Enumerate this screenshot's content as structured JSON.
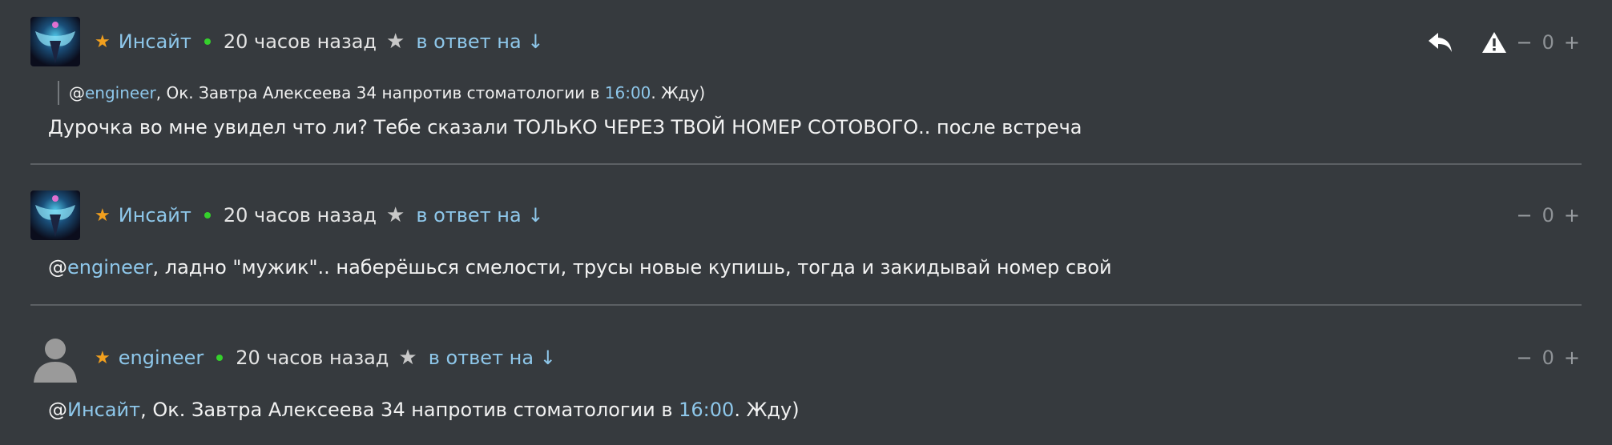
{
  "comments": [
    {
      "author": "Инсайт",
      "time": "20 часов назад",
      "reply_to": "в ответ на ↓",
      "vote_minus": "−",
      "score": "0",
      "vote_plus": "+",
      "quote": {
        "at": "@",
        "mention": "engineer",
        "text_a": ", Ок. Завтра Алексеева 34 напротив стоматологии в ",
        "time": "16:00",
        "text_b": ". Жду)"
      },
      "text": "Дурочка во мне увидел что ли? Тебе сказали ТОЛЬКО ЧЕРЕЗ ТВОЙ НОМЕР СОТОВОГО.. после встреча"
    },
    {
      "author": "Инсайт",
      "time": "20 часов назад",
      "reply_to": "в ответ на ↓",
      "vote_minus": "−",
      "score": "0",
      "vote_plus": "+",
      "at": "@",
      "mention": "engineer",
      "text": ", ладно \"мужик\".. наберёшься смелости, трусы новые купишь, тогда и закидывай номер свой"
    },
    {
      "author": "engineer",
      "time": "20 часов назад",
      "reply_to": "в ответ на ↓",
      "vote_minus": "−",
      "score": "0",
      "vote_plus": "+",
      "at": "@",
      "mention": "Инсайт",
      "text_a": ", Ок. Завтра Алексеева 34 напротив стоматологии в ",
      "time_mention": "16:00",
      "text_b": ". Жду)"
    }
  ],
  "colors": {
    "background": "#363a3e",
    "link": "#8ec7ea",
    "star": "#f2a01e",
    "online": "#35d02c",
    "divider": "#5c6064"
  },
  "icons": [
    "avatar-cosmic",
    "avatar-default",
    "star-icon",
    "online-dot",
    "bookmark-star-icon",
    "reply-icon",
    "warning-icon"
  ]
}
